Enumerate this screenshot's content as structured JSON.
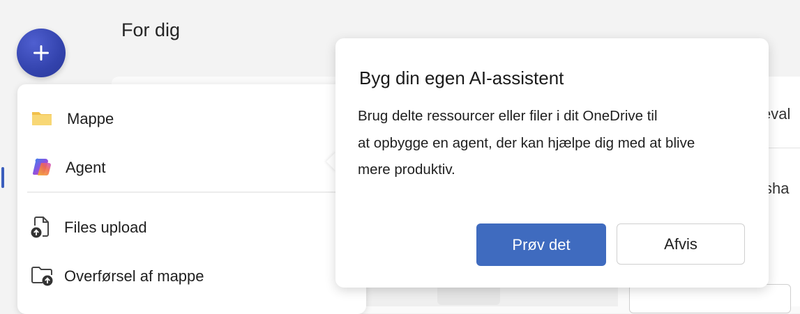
{
  "page": {
    "title": "For dig"
  },
  "new_button": {
    "icon": "plus-icon",
    "label": "+"
  },
  "background": {
    "partial_right_1": "eval",
    "partial_right_2": "l sha"
  },
  "menu": {
    "items": [
      {
        "label": "Mappe",
        "icon": "folder-icon"
      },
      {
        "label": "Agent",
        "icon": "copilot-agent-icon"
      },
      {
        "label": "Files upload",
        "icon": "file-upload-icon"
      },
      {
        "label": "Overførsel af mappe",
        "icon": "folder-upload-icon"
      }
    ]
  },
  "callout": {
    "title": "Byg din egen AI-assistent",
    "body_lines": [
      "Brug delte ressourcer eller filer i dit OneDrive til",
      "at opbygge en agent, der kan hjælpe dig med at blive",
      "mere produktiv."
    ],
    "primary_label": "Prøv det",
    "secondary_label": "Afvis"
  },
  "colors": {
    "accent": "#3f6bbf",
    "new_button": "#3343ad",
    "folder": "#f5c542"
  }
}
